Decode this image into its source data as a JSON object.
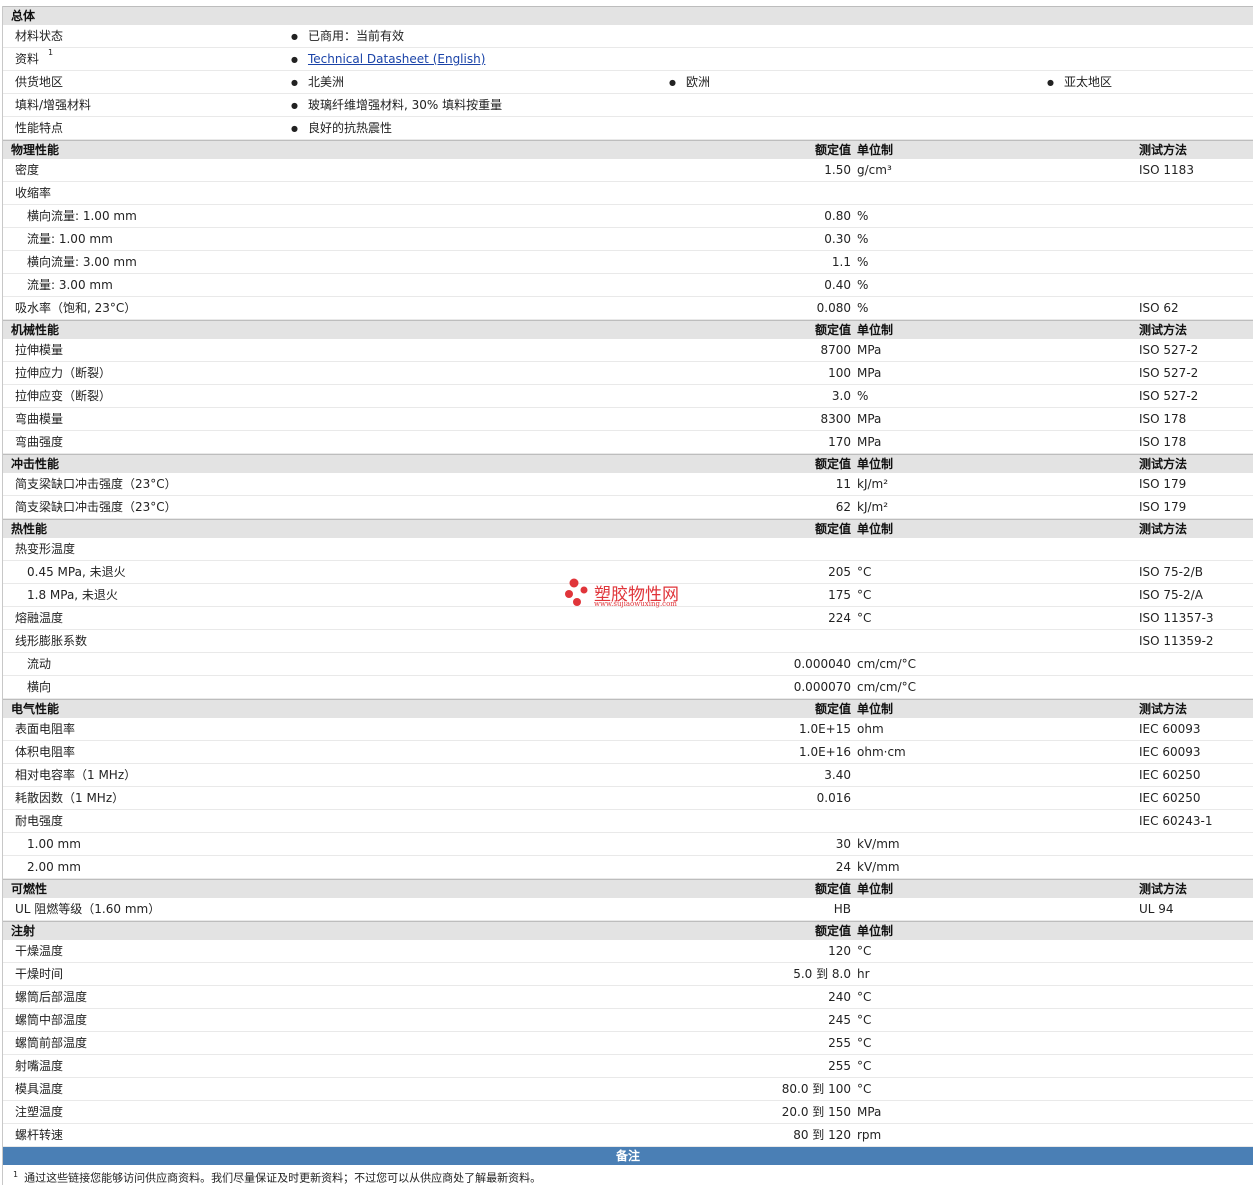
{
  "general": {
    "title": "总体",
    "rows": [
      {
        "label": "材料状态",
        "values": [
          "已商用：当前有效"
        ]
      },
      {
        "label": "资料",
        "sup": "1",
        "values": [
          "Technical Datasheet (English)"
        ],
        "link": true
      },
      {
        "label": "供货地区",
        "values": [
          "北美洲",
          "欧洲",
          "亚太地区"
        ]
      },
      {
        "label": "填料/增强材料",
        "values": [
          "玻璃纤维增强材料, 30% 填料按重量"
        ]
      },
      {
        "label": "性能特点",
        "values": [
          "良好的抗热震性"
        ]
      }
    ]
  },
  "columns": {
    "nominal": "额定值",
    "unit": "单位制",
    "test": "测试方法"
  },
  "sections": [
    {
      "title": "物理性能",
      "rows": [
        {
          "label": "密度",
          "value": "1.50",
          "unit": "g/cm³",
          "test": "ISO 1183"
        },
        {
          "label": "收缩率",
          "value": "",
          "unit": "",
          "test": ""
        },
        {
          "label": "横向流量: 1.00 mm",
          "sub": true,
          "value": "0.80",
          "unit": "%",
          "test": ""
        },
        {
          "label": "流量: 1.00 mm",
          "sub": true,
          "value": "0.30",
          "unit": "%",
          "test": ""
        },
        {
          "label": "横向流量: 3.00 mm",
          "sub": true,
          "value": "1.1",
          "unit": "%",
          "test": ""
        },
        {
          "label": "流量: 3.00 mm",
          "sub": true,
          "value": "0.40",
          "unit": "%",
          "test": ""
        },
        {
          "label": "吸水率（饱和, 23°C）",
          "value": "0.080",
          "unit": "%",
          "test": "ISO 62"
        }
      ]
    },
    {
      "title": "机械性能",
      "rows": [
        {
          "label": "拉伸模量",
          "value": "8700",
          "unit": "MPa",
          "test": "ISO 527-2"
        },
        {
          "label": "拉伸应力（断裂）",
          "value": "100",
          "unit": "MPa",
          "test": "ISO 527-2"
        },
        {
          "label": "拉伸应变（断裂）",
          "value": "3.0",
          "unit": "%",
          "test": "ISO 527-2"
        },
        {
          "label": "弯曲模量",
          "value": "8300",
          "unit": "MPa",
          "test": "ISO 178"
        },
        {
          "label": "弯曲强度",
          "value": "170",
          "unit": "MPa",
          "test": "ISO 178"
        }
      ]
    },
    {
      "title": "冲击性能",
      "rows": [
        {
          "label": "简支梁缺口冲击强度（23°C）",
          "value": "11",
          "unit": "kJ/m²",
          "test": "ISO 179"
        },
        {
          "label": "简支梁缺口冲击强度（23°C）",
          "value": "62",
          "unit": "kJ/m²",
          "test": "ISO 179"
        }
      ]
    },
    {
      "title": "热性能",
      "rows": [
        {
          "label": "热变形温度",
          "value": "",
          "unit": "",
          "test": ""
        },
        {
          "label": "0.45 MPa, 未退火",
          "sub": true,
          "value": "205",
          "unit": "°C",
          "test": "ISO 75-2/B"
        },
        {
          "label": "1.8 MPa, 未退火",
          "sub": true,
          "value": "175",
          "unit": "°C",
          "test": "ISO 75-2/A"
        },
        {
          "label": "熔融温度",
          "value": "224",
          "unit": "°C",
          "test": "ISO 11357-3"
        },
        {
          "label": "线形膨胀系数",
          "value": "",
          "unit": "",
          "test": "ISO 11359-2"
        },
        {
          "label": "流动",
          "sub": true,
          "value": "0.000040",
          "unit": "cm/cm/°C",
          "test": ""
        },
        {
          "label": "横向",
          "sub": true,
          "value": "0.000070",
          "unit": "cm/cm/°C",
          "test": ""
        }
      ]
    },
    {
      "title": "电气性能",
      "rows": [
        {
          "label": "表面电阻率",
          "value": "1.0E+15",
          "unit": "ohm",
          "test": "IEC 60093"
        },
        {
          "label": "体积电阻率",
          "value": "1.0E+16",
          "unit": "ohm·cm",
          "test": "IEC 60093"
        },
        {
          "label": "相对电容率（1 MHz）",
          "value": "3.40",
          "unit": "",
          "test": "IEC 60250"
        },
        {
          "label": "耗散因数（1 MHz）",
          "value": "0.016",
          "unit": "",
          "test": "IEC 60250"
        },
        {
          "label": "耐电强度",
          "value": "",
          "unit": "",
          "test": "IEC 60243-1"
        },
        {
          "label": "1.00 mm",
          "sub": true,
          "value": "30",
          "unit": "kV/mm",
          "test": ""
        },
        {
          "label": "2.00 mm",
          "sub": true,
          "value": "24",
          "unit": "kV/mm",
          "test": ""
        }
      ]
    },
    {
      "title": "可燃性",
      "rows": [
        {
          "label": "UL 阻燃等级（1.60 mm）",
          "value": "HB",
          "unit": "",
          "test": "UL 94"
        }
      ]
    },
    {
      "title": "注射",
      "noTest": true,
      "rows": [
        {
          "label": "干燥温度",
          "value": "120",
          "unit": "°C",
          "test": ""
        },
        {
          "label": "干燥时间",
          "value": "5.0 到  8.0",
          "unit": "hr",
          "test": ""
        },
        {
          "label": "螺筒后部温度",
          "value": "240",
          "unit": "°C",
          "test": ""
        },
        {
          "label": "螺筒中部温度",
          "value": "245",
          "unit": "°C",
          "test": ""
        },
        {
          "label": "螺筒前部温度",
          "value": "255",
          "unit": "°C",
          "test": ""
        },
        {
          "label": "射嘴温度",
          "value": "255",
          "unit": "°C",
          "test": ""
        },
        {
          "label": "模具温度",
          "value": "80.0 到  100",
          "unit": "°C",
          "test": ""
        },
        {
          "label": "注塑温度",
          "value": "20.0 到  150",
          "unit": "MPa",
          "test": ""
        },
        {
          "label": "螺杆转速",
          "value": "80 到  120",
          "unit": "rpm",
          "test": ""
        }
      ]
    }
  ],
  "notes": {
    "title": "备注",
    "footnote_num": "1",
    "footnote": "通过这些链接您能够访问供应商资料。我们尽量保证及时更新资料；不过您可以从供应商处了解最新资料。"
  },
  "watermark": {
    "title": "塑胶物性网",
    "url": "www.sujiaowuxing.com",
    "color": "#e0353a"
  }
}
